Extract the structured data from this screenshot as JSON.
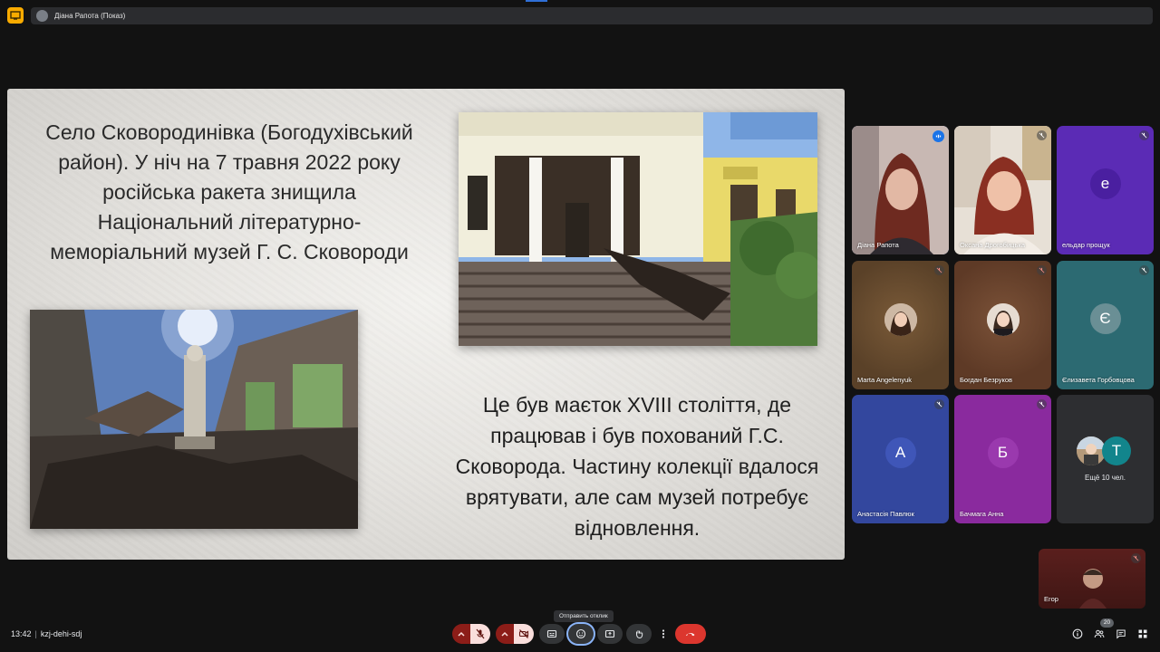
{
  "topbar": {
    "presenting_label": "Діана Рапота (Показ)"
  },
  "slide": {
    "title": "Село Сковородинівка (Богодухівський район). У ніч на 7 травня 2022 року російська ракета знищила Національний літературно-меморіальний музей Г. С. Сковороди",
    "caption": "Це був маєток XVIII століття, де працював і був похований Г.С. Сковорода. Частину колекції вдалося врятувати, але сам музей потребує відновлення."
  },
  "participants": [
    {
      "name": "Діана Рапота",
      "type": "video",
      "speaking": true
    },
    {
      "name": "Оксана Дрогобицька",
      "type": "video",
      "muted": true
    },
    {
      "name": "ельдар прощук",
      "type": "avatar",
      "initial": "е",
      "bg": "#5b2bb5",
      "avatar_bg": "#4a1fa0",
      "muted": true
    },
    {
      "name": "Marta Angelenyuk",
      "type": "photo",
      "bg": "#5a4128",
      "muted": true
    },
    {
      "name": "Богдан Безруков",
      "type": "photo",
      "bg": "#5e3a26",
      "muted": true
    },
    {
      "name": "Єлизавета Горбовцова",
      "type": "avatar",
      "initial": "Є",
      "bg": "#2c6a72",
      "avatar_bg": "#6a8f95",
      "muted": true
    },
    {
      "name": "Анастасія Павлюк",
      "type": "avatar",
      "initial": "А",
      "bg": "#33479e",
      "avatar_bg": "#3f56b8",
      "muted": true
    },
    {
      "name": "Бачмага Анна",
      "type": "avatar",
      "initial": "Б",
      "bg": "#8a2a9e",
      "avatar_bg": "#9a39ae",
      "muted": true
    }
  ],
  "more_participants": {
    "label": "Ещё 10 чел.",
    "second_initial": "Т"
  },
  "self_view": {
    "name": "Егор"
  },
  "bottombar": {
    "time": "13:42",
    "meeting_code": "kzj-dehi-sdj",
    "tooltip": "Отправить отклик",
    "participant_count": "20"
  },
  "colors": {
    "accent": "#8ab4f8",
    "danger": "#dc362e",
    "muted_red": "#8c1d18"
  }
}
